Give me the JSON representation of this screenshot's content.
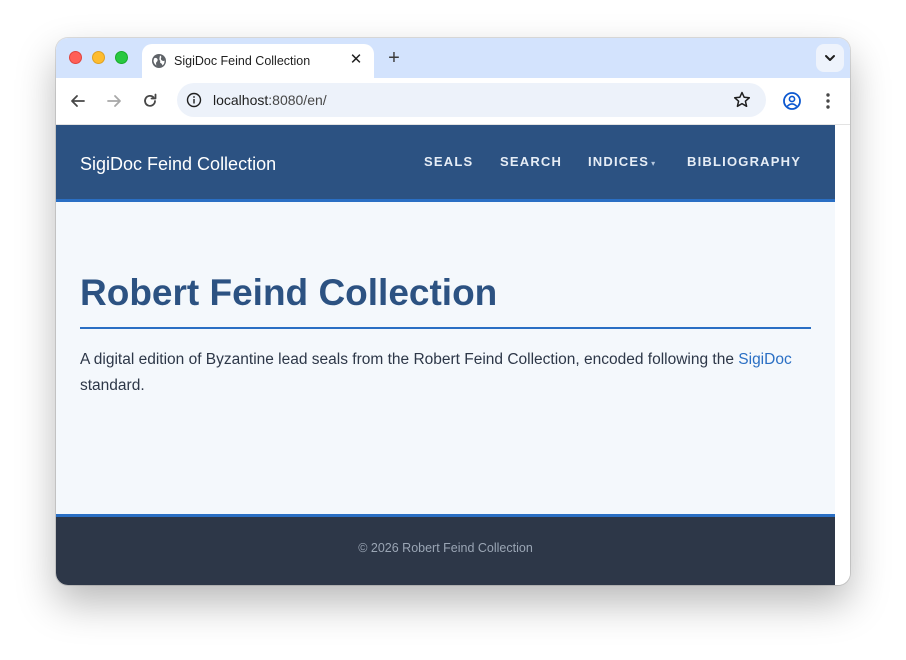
{
  "browser": {
    "tab_title": "SigiDoc Feind Collection",
    "tab_close": "✕",
    "new_tab": "+",
    "url_host": "localhost",
    "url_path": ":8080/en/"
  },
  "site": {
    "brand": "SigiDoc Feind Collection",
    "nav": {
      "seals": "SEALS",
      "search": "SEARCH",
      "indices": "INDICES",
      "indices_caret": "▾",
      "bibliography": "BIBLIOGRAPHY"
    }
  },
  "main": {
    "title": "Robert Feind Collection",
    "intro_text": "A digital edition of Byzantine lead seals from the Robert Feind Collection, encoded following the ",
    "intro_link": "SigiDoc",
    "intro_tail": " standard."
  },
  "footer": {
    "copyright": "© 2026 Robert Feind Collection"
  },
  "colors": {
    "header_bg": "#2c5282",
    "accent": "#2a6fc4",
    "page_bg": "#f4f8fc",
    "footer_bg": "#2d3748",
    "tabstrip_bg": "#d3e3fd"
  },
  "icons": {
    "close": "close-icon",
    "minimize": "minimize-icon",
    "zoom": "zoom-icon",
    "favicon": "globe-icon",
    "back": "back-arrow-icon",
    "forward": "forward-arrow-icon",
    "reload": "reload-icon",
    "site_info": "info-icon",
    "bookmark": "star-icon",
    "profile": "profile-icon",
    "menu": "kebab-menu-icon",
    "tab_search": "chevron-down-icon"
  }
}
